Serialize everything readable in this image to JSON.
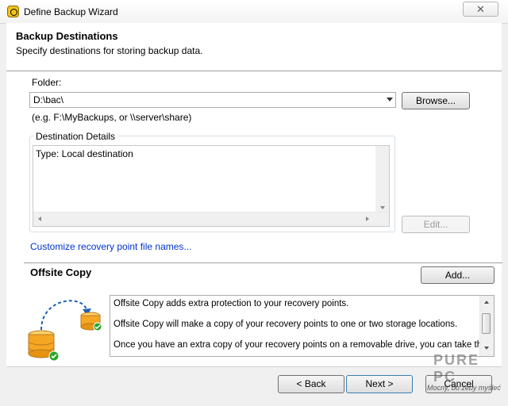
{
  "window": {
    "title": "Define Backup Wizard",
    "close_glyph": "✕"
  },
  "header": {
    "title": "Backup Destinations",
    "subtitle": "Specify destinations for storing backup data."
  },
  "folder": {
    "label": "Folder:",
    "value": "D:\\bac\\",
    "browse_label": "Browse...",
    "hint": "(e.g. F:\\MyBackups, or \\\\server\\share)"
  },
  "details": {
    "legend": "Destination Details",
    "text": "Type: Local destination",
    "edit_label": "Edit..."
  },
  "customize_link": "Customize recovery point file names...",
  "offsite": {
    "title": "Offsite Copy",
    "add_label": "Add...",
    "lines": [
      "Offsite Copy adds extra protection to your recovery points.",
      "Offsite Copy will make a copy of your recovery points to one or two storage locations.",
      "Once you have an extra copy of your recovery points on a removable drive, you can take them to"
    ]
  },
  "footer": {
    "back_label": "< Back",
    "next_label": "Next >",
    "cancel_label": "Cancel"
  },
  "watermark": {
    "line1": "PURE PC",
    "line2": "Mocny, bo żeby myśleć"
  },
  "colors": {
    "link": "#0033cc",
    "disk_gold": "#f5a623",
    "check_green": "#2aa52a",
    "arrow_blue": "#1f5fb4"
  }
}
